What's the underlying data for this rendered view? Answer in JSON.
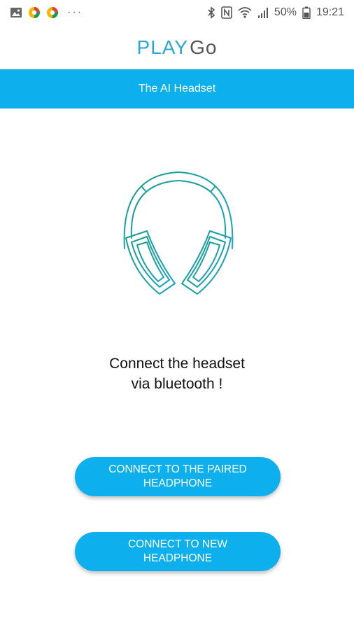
{
  "status_bar": {
    "battery": "50%",
    "time": "19:21",
    "more": "···"
  },
  "app": {
    "logo_play": "PLAY",
    "logo_go": "Go",
    "title": "The AI Headset"
  },
  "message": {
    "line1": "Connect the headset",
    "line2": "via bluetooth !"
  },
  "buttons": {
    "paired": "CONNECT TO THE PAIRED HEADPHONE",
    "new": "CONNECT TO NEW HEADPHONE"
  },
  "colors": {
    "accent": "#0db0ec",
    "headphone_gradient_start": "#1a9e8a",
    "headphone_gradient_end": "#1aa3c8"
  },
  "icons": [
    "image-icon",
    "app-icon",
    "app-icon",
    "bluetooth-icon",
    "nfc-icon",
    "wifi-icon",
    "signal-icon",
    "battery-icon",
    "headphone-icon"
  ]
}
